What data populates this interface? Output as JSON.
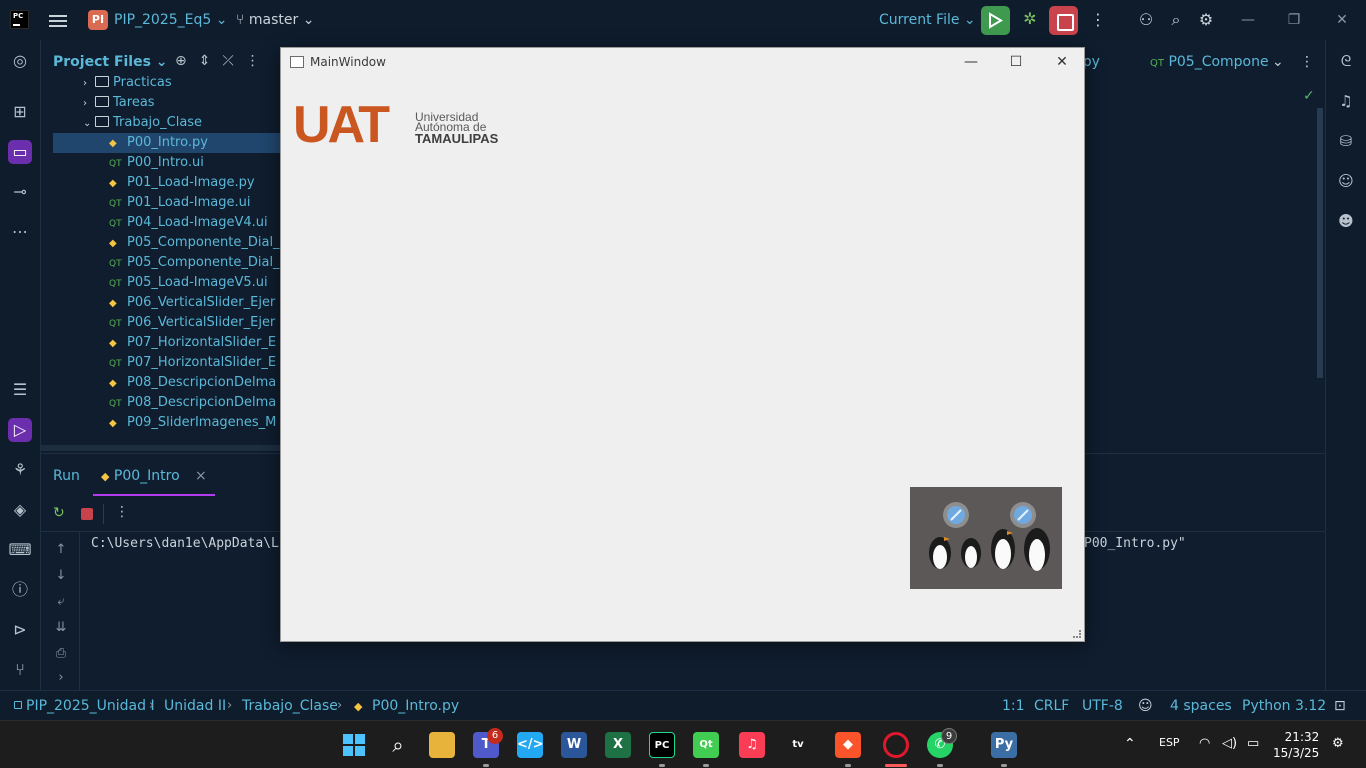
{
  "ide": {
    "project_badge": "PI",
    "project_name": "PIP_2025_Eq5",
    "branch": "master",
    "run_config": "Current File"
  },
  "project_panel": {
    "title": "Project Files",
    "folders": [
      {
        "label": "Practicas",
        "expanded": false
      },
      {
        "label": "Tareas",
        "expanded": false
      },
      {
        "label": "Trabajo_Clase",
        "expanded": true
      }
    ],
    "files": [
      {
        "label": "P00_Intro.py",
        "type": "py",
        "selected": true
      },
      {
        "label": "P00_Intro.ui",
        "type": "qt"
      },
      {
        "label": "P01_Load-Image.py",
        "type": "py"
      },
      {
        "label": "P01_Load-Image.ui",
        "type": "qt"
      },
      {
        "label": "P04_Load-ImageV4.ui",
        "type": "qt"
      },
      {
        "label": "P05_Componente_Dial_",
        "type": "py"
      },
      {
        "label": "P05_Componente_Dial_",
        "type": "qt"
      },
      {
        "label": "P05_Load-ImageV5.ui",
        "type": "qt"
      },
      {
        "label": "P06_VerticalSlider_Ejer",
        "type": "py"
      },
      {
        "label": "P06_VerticalSlider_Ejer",
        "type": "qt"
      },
      {
        "label": "P07_HorizontalSlider_E",
        "type": "py"
      },
      {
        "label": "P07_HorizontalSlider_E",
        "type": "qt"
      },
      {
        "label": "P08_DescripcionDelma",
        "type": "py"
      },
      {
        "label": "P08_DescripcionDelma",
        "type": "qt"
      },
      {
        "label": "P09_SliderImagenes_M",
        "type": "py"
      }
    ]
  },
  "editor_tabs": [
    {
      "label": "o.py"
    },
    {
      "label": "P05_Compone"
    }
  ],
  "run_panel": {
    "title": "Run",
    "tab_label": "P00_Intro",
    "console_left": "C:\\Users\\dan1e\\AppData\\L",
    "console_right": "P00_Intro.py\""
  },
  "status": {
    "breadcrumbs": [
      "PIP_2025_Unidad I",
      "Unidad II",
      "Trabajo_Clase",
      "P00_Intro.py"
    ],
    "position": "1:1",
    "line_sep": "CRLF",
    "encoding": "UTF-8",
    "indent": "4 spaces",
    "interpreter": "Python 3.12"
  },
  "mainwindow": {
    "title": "MainWindow",
    "logo_main": "UAT",
    "logo_line1": "Universidad",
    "logo_line2": "Autónoma de",
    "logo_line3": "TAMAULIPAS",
    "colors": {
      "logo_orange": "#c9571f",
      "logo_gray": "#5a5a5a"
    }
  },
  "taskbar": {
    "teams_badge": "6",
    "whatsapp_badge": "9",
    "language": "ESP",
    "time": "21:32",
    "date": "15/3/25"
  },
  "colors": {
    "accent": "#5bb8d8",
    "background": "#0f1d2e",
    "run_green": "#3f9a4f",
    "stop_red": "#c8434b",
    "selection": "#21466e"
  }
}
